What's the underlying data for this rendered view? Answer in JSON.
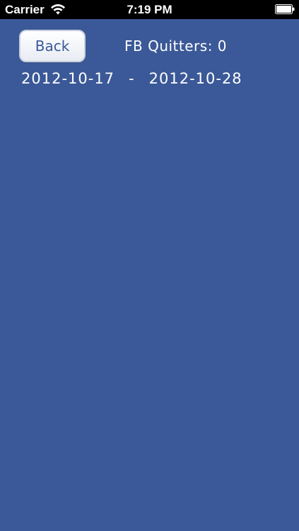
{
  "status_bar": {
    "carrier": "Carrier",
    "time": "7:19 PM",
    "icons": {
      "wifi": "wifi-icon",
      "battery": "battery-icon"
    }
  },
  "header": {
    "back_label": "Back",
    "quitters_label": "FB Quitters:",
    "quitters_count": "0"
  },
  "date_range": {
    "start": "2012-10-17",
    "separator": "-",
    "end": "2012-10-28"
  },
  "colors": {
    "background": "#3b5998",
    "button_text": "#3b5998",
    "text": "#ffffff"
  }
}
